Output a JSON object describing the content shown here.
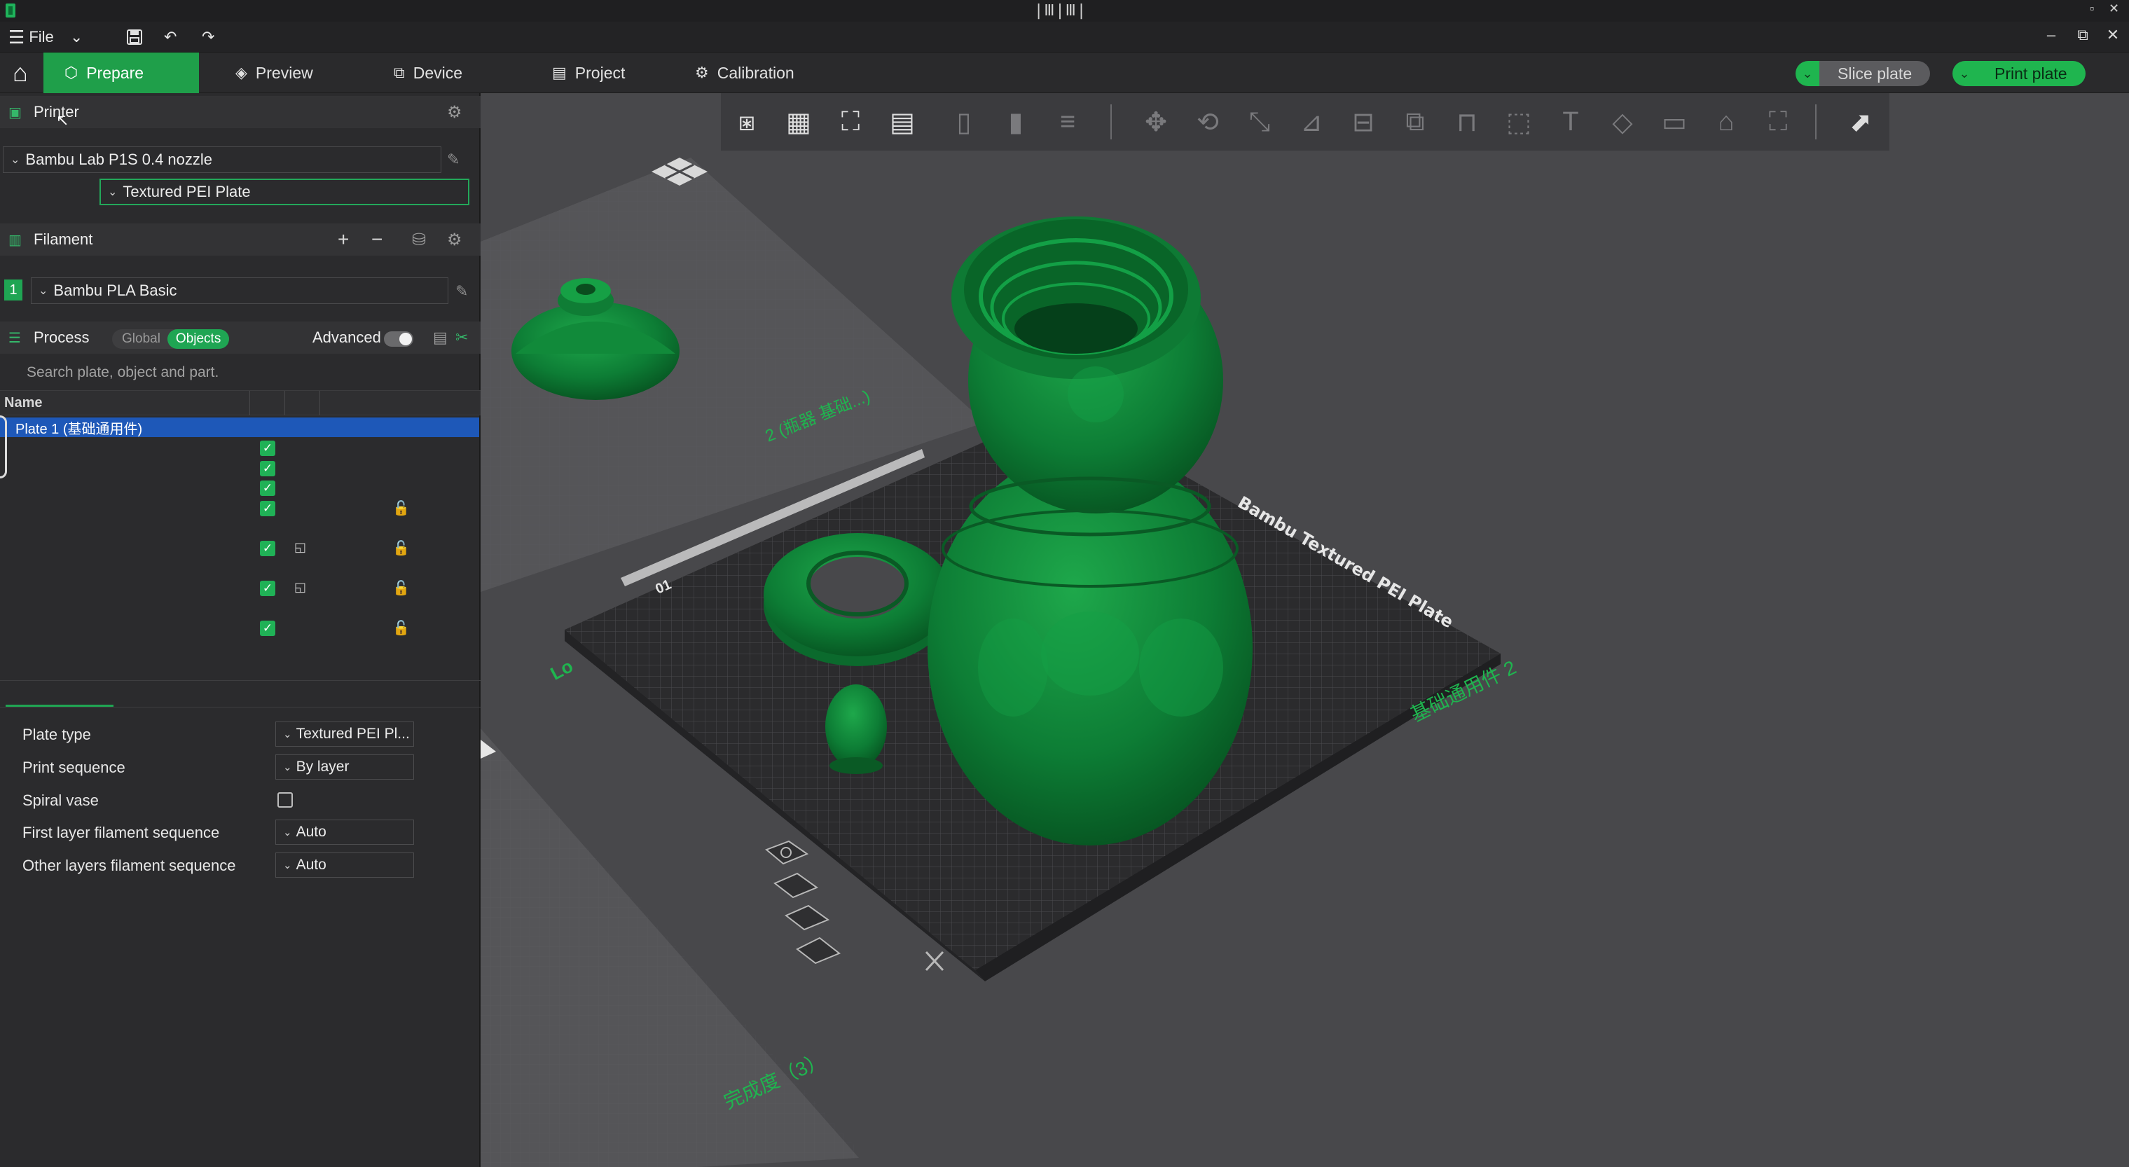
{
  "app": {
    "title_glyphs": "|Ⅲ|Ⅲ|",
    "colors": {
      "accent": "#1fa553",
      "model_green": "#0f8a3c",
      "selection_blue": "#1e58b8",
      "lock_orange": "#f08b1d"
    }
  },
  "menubar": {
    "file_label": "File",
    "icons": [
      "hamburger-icon",
      "chevron-down-icon",
      "save-icon",
      "undo-icon",
      "redo-icon"
    ]
  },
  "tabs": [
    {
      "label": "Prepare",
      "icon": "cube-icon",
      "active": true
    },
    {
      "label": "Preview",
      "icon": "layers-icon",
      "active": false
    },
    {
      "label": "Device",
      "icon": "device-icon",
      "active": false
    },
    {
      "label": "Project",
      "icon": "project-icon",
      "active": false
    },
    {
      "label": "Calibration",
      "icon": "gauge-icon",
      "active": false
    }
  ],
  "actions": {
    "slice_label": "Slice plate",
    "print_label": "Print plate"
  },
  "printer": {
    "section_title": "Printer",
    "printer_name": "Bambu Lab P1S 0.4 nozzle",
    "plate": "Textured PEI Plate"
  },
  "filament": {
    "section_title": "Filament",
    "slot_number": "1",
    "name": "Bambu PLA Basic",
    "add_symbol": "+",
    "remove_symbol": "−"
  },
  "process": {
    "section_title": "Process",
    "mode_global": "Global",
    "mode_objects": "Objects",
    "advanced_label": "Advanced",
    "advanced_enabled": true,
    "search_placeholder": "Search plate, object and part."
  },
  "object_list": {
    "column_name": "Name",
    "selected_row": "Plate 1 (基础通用件)"
  },
  "plate_settings": {
    "plate_type_label": "Plate type",
    "plate_type_value": "Textured PEI Pl...",
    "print_sequence_label": "Print sequence",
    "print_sequence_value": "By layer",
    "spiral_vase_label": "Spiral vase",
    "spiral_vase_checked": false,
    "first_layer_label": "First layer filament sequence",
    "first_layer_value": "Auto",
    "other_layers_label": "Other layers filament sequence",
    "other_layers_value": "Auto"
  },
  "viewport": {
    "bed_label": "Bambu Textured PEI Plate",
    "bed_number": "01",
    "plate_label_main": "基础通用件 2",
    "plate_label_top": "2 (瓶器 基础...)",
    "plate_label_bottom": "完成度（3）",
    "corner_label": "Lo",
    "toolbar_icons": [
      "add-object-icon",
      "arrange-grid-icon",
      "auto-orient-icon",
      "split-layout-icon",
      "object-icon",
      "part-icon",
      "layers-icon",
      "move-icon",
      "rotate-icon",
      "scale-icon",
      "lay-on-face-icon",
      "cut-icon",
      "boolean-icon",
      "support-paint-icon",
      "seam-paint-icon",
      "text-icon",
      "color-paint-icon",
      "measure-icon",
      "assembly-icon",
      "fit-icon",
      "view-switch-icon"
    ]
  }
}
